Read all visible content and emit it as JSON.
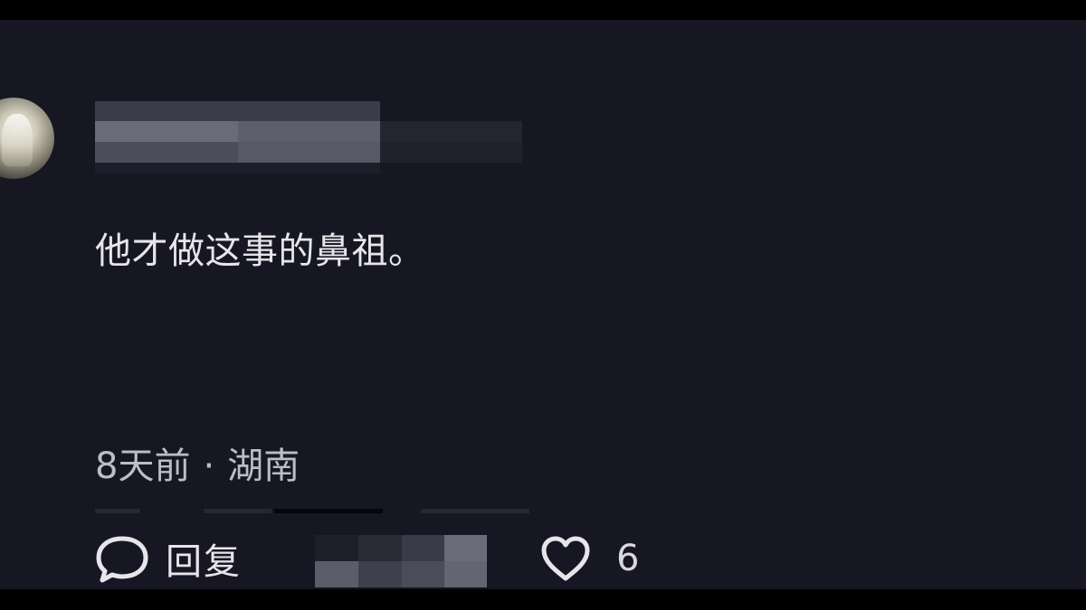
{
  "comment": {
    "text": "他才做这事的鼻祖。",
    "time": "8天前",
    "separator": "·",
    "location": "湖南"
  },
  "actions": {
    "reply_label": "回复",
    "like_count": "6"
  },
  "icons": {
    "reply": "chat-bubble-icon",
    "like": "heart-outline-icon"
  },
  "colors": {
    "background": "#161722",
    "text": "#e6e6ea",
    "meta_text": "#bdbdc6",
    "blur": "#5c5d6a"
  }
}
